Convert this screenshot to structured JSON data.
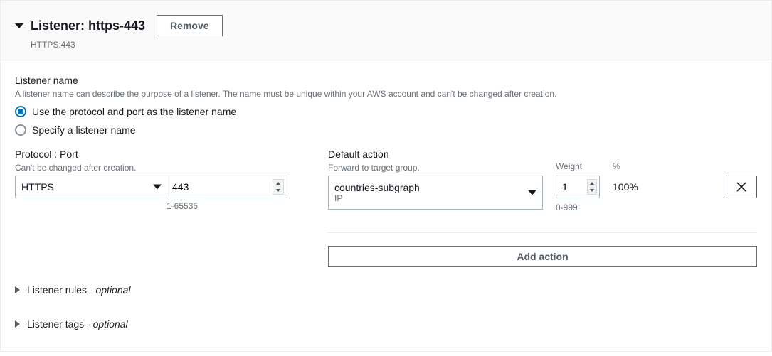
{
  "header": {
    "title": "Listener: https-443",
    "subtitle": "HTTPS:443",
    "remove": "Remove"
  },
  "name_section": {
    "label": "Listener name",
    "description": "A listener name can describe the purpose of a listener. The name must be unique within your AWS account and can't be changed after creation.",
    "option1": "Use the protocol and port as the listener name",
    "option2": "Specify a listener name"
  },
  "protocol_port": {
    "label": "Protocol : Port",
    "hint": "Can't be changed after creation.",
    "protocol": "HTTPS",
    "port": "443",
    "port_range": "1-65535"
  },
  "action": {
    "label": "Default action",
    "hint": "Forward to target group.",
    "target_name": "countries-subgraph",
    "target_type": "IP",
    "weight_label": "Weight",
    "weight_value": "1",
    "weight_range": "0-999",
    "percent_label": "%",
    "percent_value": "100%",
    "add_action": "Add action"
  },
  "sections": {
    "rules_prefix": "Listener rules - ",
    "rules_optional": "optional",
    "tags_prefix": "Listener tags - ",
    "tags_optional": "optional"
  }
}
